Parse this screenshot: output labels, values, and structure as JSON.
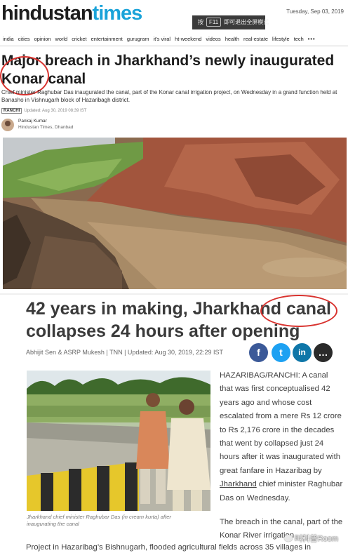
{
  "ht": {
    "logo_part1": "hindustan",
    "logo_part2": "times",
    "fullscreen_hint_pre": "按",
    "fullscreen_hint_key": "F11",
    "fullscreen_hint_post": "即可退出全屏模式",
    "date": "Tuesday, Sep 03, 2019",
    "nav": [
      "india",
      "cities",
      "opinion",
      "world",
      "cricket",
      "entertainment",
      "gurugram",
      "it's viral",
      "ht-weekend",
      "videos",
      "health",
      "real-estate",
      "lifestyle",
      "tech"
    ],
    "nav_more": "•••",
    "headline": "Major breach in Jharkhand’s newly inaugurated Konar canal",
    "summary": "Chief minister Raghubar Das inaugurated the canal, part of the Konar canal irrigation project, on Wednesday in a grand function held at Banasho in Vishnugarh block of Hazaribagh district.",
    "tag": "RANCHI",
    "updated": "Updated: Aug 30, 2019 08:39 IST",
    "author": "Pankaj Kumar",
    "author_org": "Hindustan Times, Dhanbad"
  },
  "toi": {
    "headline": "42 years in making, Jharkhand canal collapses 24 hours after opening",
    "byline": "Abhijit Sen & ASRP Mukesh | TNN | Updated: Aug 30, 2019, 22:29 IST",
    "share": [
      "f",
      "t",
      "in",
      "…"
    ],
    "caption": "Jharkhand chief minister Raghubar Das (in cream kurta) after inaugurating the canal",
    "para1_a": "HAZARIBAG/RANCHI: A canal that was first conceptualised 42 years ago and whose cost escalated from a mere Rs 12 crore to Rs 2,176 crore in the decades that went by collapsed just 24 hours after it was inaugurated with great fanfare in Hazaribag by ",
    "para1_link": "Jharkhand",
    "para1_b": " chief minister Raghubar Das on Wednesday.",
    "para2": "The breach in the canal, part of the Konar River irrigation",
    "para2_cont": "Project in Hazaribag’s Bishnugarh, flooded agricultural fields across 35 villages in"
  },
  "watermark": "叫科普Room",
  "colors": {
    "ht_blue": "#1aa3d9",
    "ring_red": "#d8322e",
    "facebook": "#3b5998",
    "twitter": "#1da1f2",
    "linkedin": "#0e76a8"
  }
}
